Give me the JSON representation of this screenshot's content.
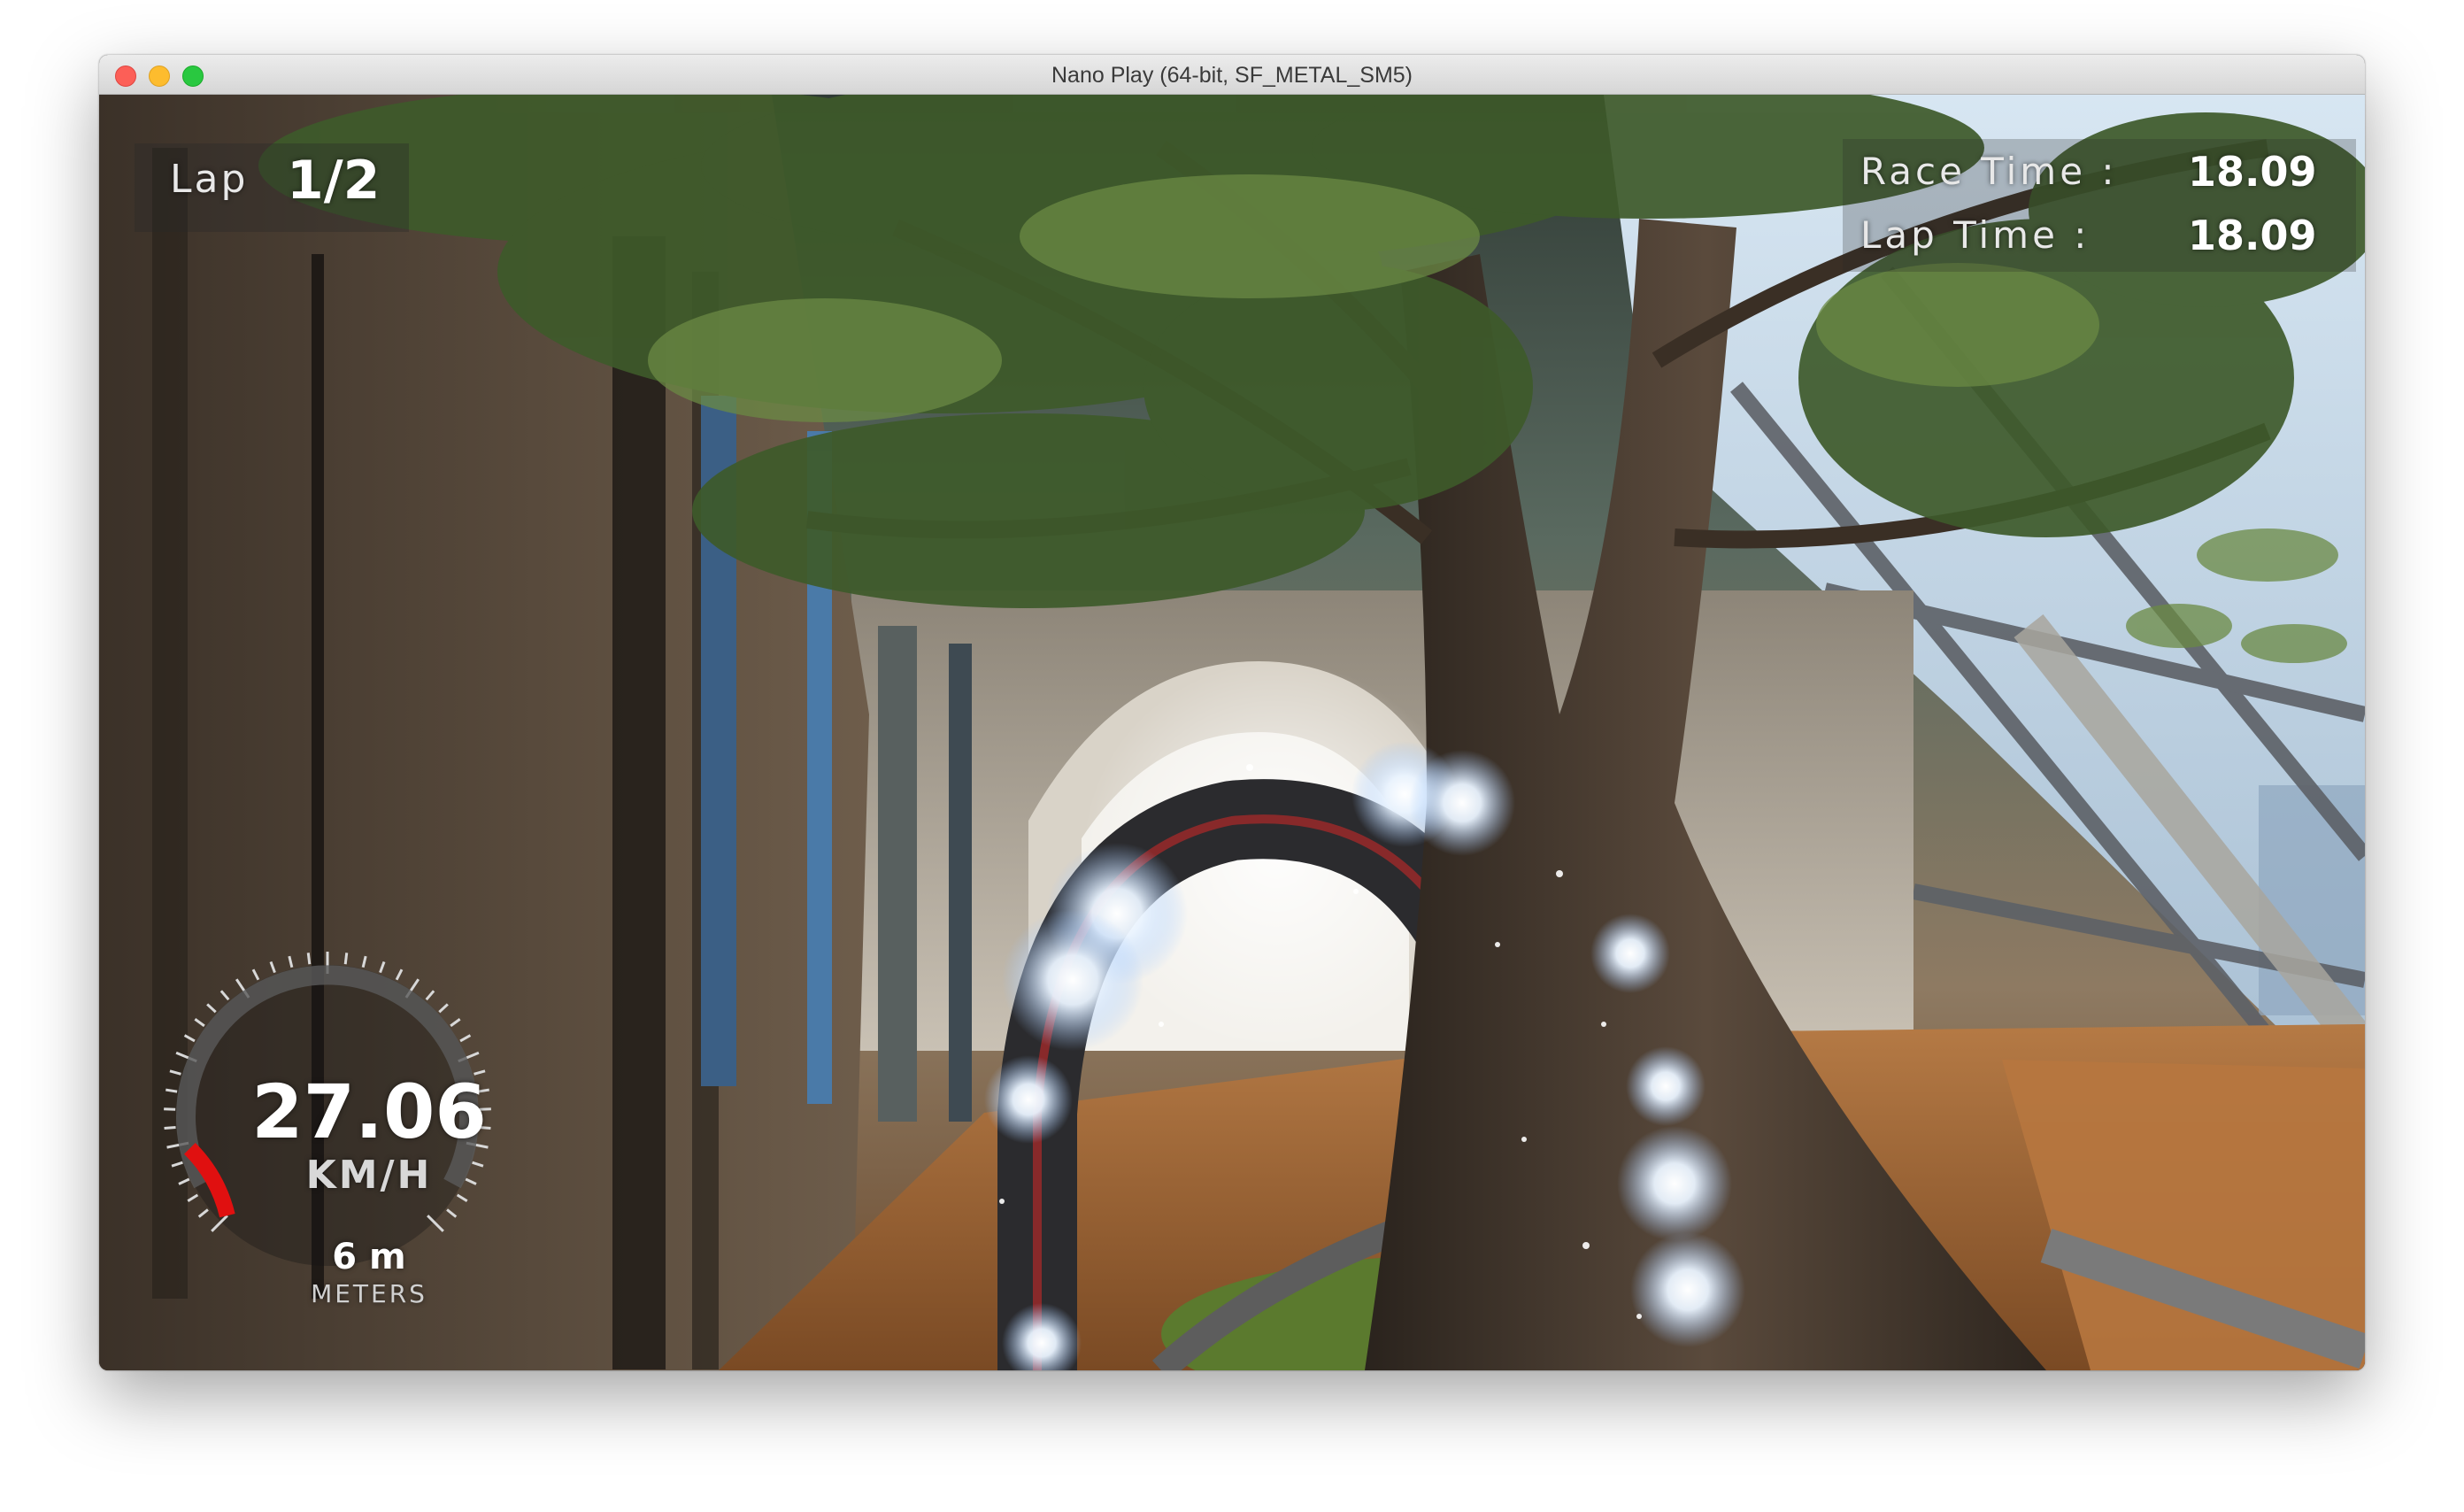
{
  "window": {
    "title": "Nano Play (64-bit, SF_METAL_SM5)"
  },
  "hud": {
    "lap_label": "Lap",
    "lap_value": "1/2",
    "race_time_label": "Race Time :",
    "race_time_value": "18.09",
    "lap_time_label": "Lap Time :",
    "lap_time_value": "18.09",
    "speed_value": "27.06",
    "speed_unit": "KM/H",
    "distance_value": "6 m",
    "distance_unit": "METERS",
    "speed_gauge_fraction": 0.12
  },
  "colors": {
    "gauge_fill": "#e01010",
    "hud_text": "#ffffff",
    "orb_glow": "#cfe4ff"
  },
  "icons": [
    "close-button-icon",
    "minimize-button-icon",
    "maximize-button-icon"
  ]
}
